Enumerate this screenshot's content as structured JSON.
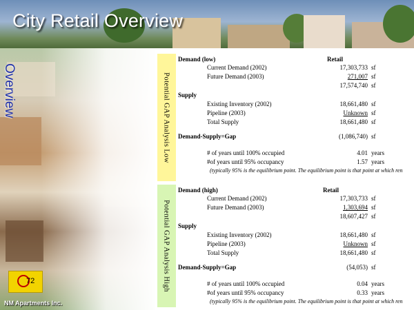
{
  "title": "City Retail Overview",
  "sidebar_word": "Overview",
  "logo": {
    "number": "72",
    "org": "NM Apartments Inc."
  },
  "low": {
    "rail_label": "Potential GAP Analysis Low",
    "demand_header": "Demand (low)",
    "col_header": "Retail",
    "rows": [
      {
        "label": "Current Demand (2002)",
        "value": "17,303,733",
        "unit": "sf"
      },
      {
        "label": "Future Demand (2003)",
        "value": "271,007",
        "unit": "sf"
      },
      {
        "label": "",
        "value": "17,574,740",
        "unit": "sf"
      }
    ],
    "supply_header": "Supply",
    "supply_rows": [
      {
        "label": "Existing Inventory (2002)",
        "value": "18,661,480",
        "unit": "sf"
      },
      {
        "label": "Pipeline (2003)",
        "value": "Unknown",
        "unit": "sf"
      },
      {
        "label": "Total Supply",
        "value": "18,661,480",
        "unit": "sf"
      }
    ],
    "gap_label": "Demand-Supply=Gap",
    "gap_value": "(1,086,740)",
    "gap_unit": "sf",
    "years_rows": [
      {
        "label": "# of years until 100% occupied",
        "value": "4.01",
        "unit": "years"
      },
      {
        "label": "#of years until 95% occupancy",
        "value": "1.57",
        "unit": "years"
      }
    ],
    "note": "(typically 95% is the equilibrium point.  The equilibrium point is that point at which ren"
  },
  "high": {
    "rail_label": "Potential GAP Analysis High",
    "demand_header": "Demand (high)",
    "col_header": "Retail",
    "rows": [
      {
        "label": "Current Demand (2002)",
        "value": "17,303,733",
        "unit": "sf"
      },
      {
        "label": "Future Demand (2003)",
        "value": "1,303,694",
        "unit": "sf"
      },
      {
        "label": "",
        "value": "18,607,427",
        "unit": "sf"
      }
    ],
    "supply_header": "Supply",
    "supply_rows": [
      {
        "label": "Existing Inventory (2002)",
        "value": "18,661,480",
        "unit": "sf"
      },
      {
        "label": "Pipeline (2003)",
        "value": "Unknown",
        "unit": "sf"
      },
      {
        "label": "Total Supply",
        "value": "18,661,480",
        "unit": "sf"
      }
    ],
    "gap_label": "Demand-Supply=Gap",
    "gap_value": "(54,053)",
    "gap_unit": "sf",
    "years_rows": [
      {
        "label": "# of years until 100% occupied",
        "value": "0.04",
        "unit": "years"
      },
      {
        "label": "#of years until 95% occupancy",
        "value": "0.33",
        "unit": "years"
      }
    ],
    "note": "(typically 95% is the equilibrium point.  The equilibrium point is that point at which ren"
  }
}
